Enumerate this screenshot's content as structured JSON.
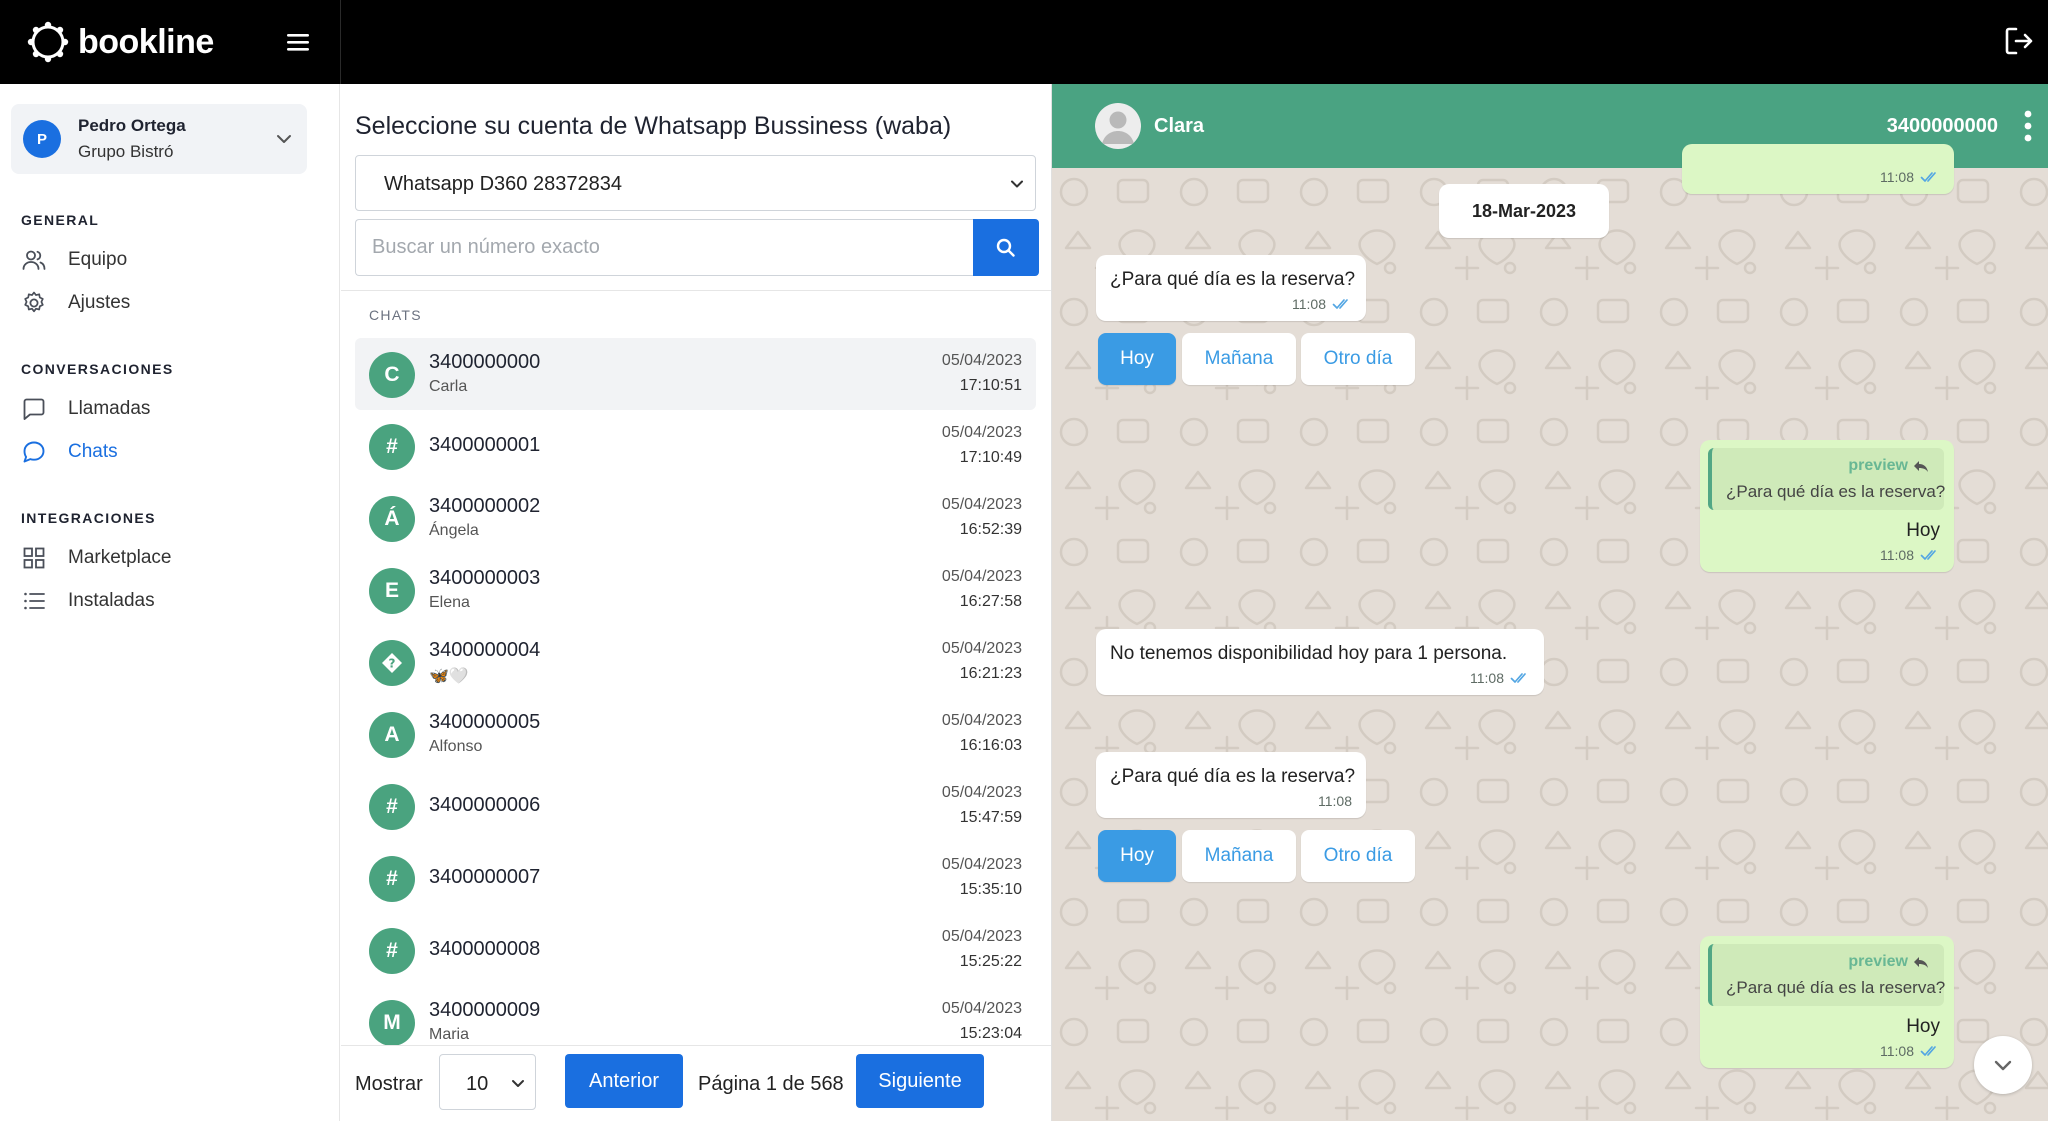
{
  "app": {
    "brand": "bookline",
    "colors": {
      "primary": "#1a6fe0",
      "header_green": "#4aa382",
      "avatar_green": "#4aa37f",
      "bubble_out": "#dcf7c5",
      "quick_reply": "#3a9be4"
    },
    "icons": {
      "menu": "hamburger-icon",
      "logout": "logout-icon"
    }
  },
  "user": {
    "initial": "P",
    "name": "Pedro Ortega",
    "org": "Grupo Bistró"
  },
  "sidebar": {
    "sections": [
      {
        "title": "GENERAL",
        "items": [
          {
            "label": "Equipo",
            "icon": "users-icon"
          },
          {
            "label": "Ajustes",
            "icon": "gear-icon"
          }
        ]
      },
      {
        "title": "CONVERSACIONES",
        "items": [
          {
            "label": "Llamadas",
            "icon": "message-square-icon"
          },
          {
            "label": "Chats",
            "icon": "chat-bubble-icon",
            "active": true
          }
        ]
      },
      {
        "title": "INTEGRACIONES",
        "items": [
          {
            "label": "Marketplace",
            "icon": "grid-icon"
          },
          {
            "label": "Instaladas",
            "icon": "list-icon"
          }
        ]
      }
    ]
  },
  "chat_list": {
    "title": "Seleccione su cuenta de Whatsapp Bussiness (waba)",
    "account": "Whatsapp D360 28372834",
    "search_placeholder": "Buscar un número exacto",
    "section_label": "CHATS",
    "items": [
      {
        "initial": "C",
        "number": "3400000000",
        "name": "Carla",
        "date": "05/04/2023",
        "time": "17:10:51",
        "selected": true
      },
      {
        "initial": "#",
        "number": "3400000001",
        "name": "",
        "date": "05/04/2023",
        "time": "17:10:49"
      },
      {
        "initial": "Á",
        "number": "3400000002",
        "name": "Ángela",
        "date": "05/04/2023",
        "time": "16:52:39"
      },
      {
        "initial": "E",
        "number": "3400000003",
        "name": "Elena",
        "date": "05/04/2023",
        "time": "16:27:58"
      },
      {
        "initial": "?",
        "number": "3400000004",
        "name": "🦋🤍",
        "date": "05/04/2023",
        "time": "16:21:23"
      },
      {
        "initial": "A",
        "number": "3400000005",
        "name": "Alfonso",
        "date": "05/04/2023",
        "time": "16:16:03"
      },
      {
        "initial": "#",
        "number": "3400000006",
        "name": "",
        "date": "05/04/2023",
        "time": "15:47:59"
      },
      {
        "initial": "#",
        "number": "3400000007",
        "name": "",
        "date": "05/04/2023",
        "time": "15:35:10"
      },
      {
        "initial": "#",
        "number": "3400000008",
        "name": "",
        "date": "05/04/2023",
        "time": "15:25:22"
      },
      {
        "initial": "M",
        "number": "3400000009",
        "name": "Maria",
        "date": "05/04/2023",
        "time": "15:23:04"
      }
    ],
    "pagination": {
      "show_label": "Mostrar",
      "page_size": "10",
      "prev": "Anterior",
      "info": "Página 1 de 568",
      "next": "Siguiente"
    }
  },
  "conversation": {
    "contact_name": "Clara",
    "contact_phone": "3400000000",
    "date_separator": "18-Mar-2023",
    "top_partial_time": "11:08",
    "messages": [
      {
        "text": "¿Para qué día es la reserva?",
        "time": "11:08",
        "ticks": true,
        "quick_replies": [
          "Hoy",
          "Mañana",
          "Otro día"
        ],
        "active_reply": "Hoy"
      },
      {
        "quote_author": "preview",
        "quote_text": "¿Para qué día es la reserva?",
        "text": "Hoy",
        "time": "11:08"
      },
      {
        "text": "No tenemos disponibilidad hoy para 1 persona.",
        "time": "11:08",
        "ticks": true
      },
      {
        "text": "¿Para qué día es la reserva?",
        "time": "11:08",
        "ticks": false,
        "quick_replies": [
          "Hoy",
          "Mañana",
          "Otro día"
        ],
        "active_reply": "Hoy"
      },
      {
        "quote_author": "preview",
        "quote_text": "¿Para qué día es la reserva?",
        "text": "Hoy",
        "time": "11:08"
      }
    ]
  }
}
